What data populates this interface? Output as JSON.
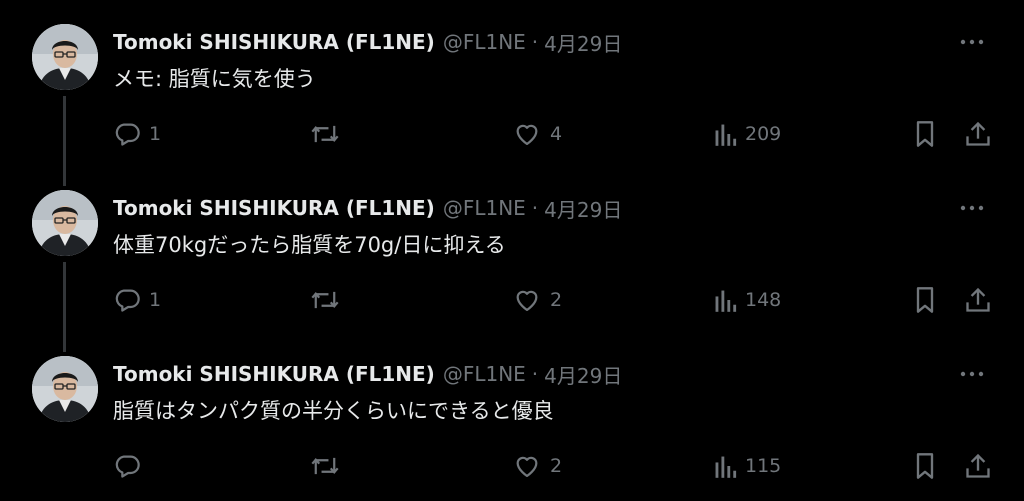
{
  "author": {
    "name": "Tomoki SHISHIKURA (FL1NE)",
    "handle": "@FL1NE",
    "separator": "·"
  },
  "colors": {
    "background": "#000000",
    "text_primary": "#e7e9ea",
    "text_secondary": "#71767b",
    "thread_line": "#333639"
  },
  "icons": [
    "reply-icon",
    "retweet-icon",
    "like-icon",
    "views-icon",
    "bookmark-icon",
    "share-icon",
    "more-options-icon",
    "avatar"
  ],
  "tweets": [
    {
      "date": "4月29日",
      "text": "メモ: 脂質に気を使う",
      "replies": "1",
      "retweets": "",
      "likes": "4",
      "views": "209"
    },
    {
      "date": "4月29日",
      "text": "体重70kgだったら脂質を70g/日に抑える",
      "replies": "1",
      "retweets": "",
      "likes": "2",
      "views": "148"
    },
    {
      "date": "4月29日",
      "text": "脂質はタンパク質の半分くらいにできると優良",
      "replies": "",
      "retweets": "",
      "likes": "2",
      "views": "115"
    }
  ]
}
